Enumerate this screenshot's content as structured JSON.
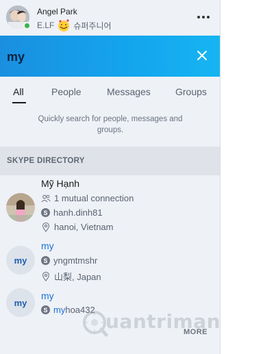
{
  "header": {
    "user_name": "Angel Park",
    "status_prefix": "E.LF",
    "status_suffix": "슈퍼주니어",
    "more_icon": "more-horizontal-icon"
  },
  "search": {
    "query": "my",
    "clear_icon": "close-icon",
    "accent_color": "#1a8fe0"
  },
  "tabs": [
    {
      "label": "All",
      "active": true
    },
    {
      "label": "People",
      "active": false
    },
    {
      "label": "Messages",
      "active": false
    },
    {
      "label": "Groups",
      "active": false
    }
  ],
  "hint": "Quickly search for people, messages and groups.",
  "section": {
    "label": "SKYPE DIRECTORY"
  },
  "results": [
    {
      "name": "Mỹ Hạnh",
      "mutual": "1 mutual connection",
      "skype_id": "hanh.dinh81",
      "location": "hanoi, Vietnam"
    },
    {
      "initials": "my",
      "name": "my",
      "skype_id": "yngmtmshr",
      "location": "山梨, Japan"
    },
    {
      "initials": "my",
      "name": "my",
      "skype_id_highlight": "my",
      "skype_id_rest": "hoa432"
    }
  ],
  "more_label": "MORE",
  "watermark": "uantrimang"
}
